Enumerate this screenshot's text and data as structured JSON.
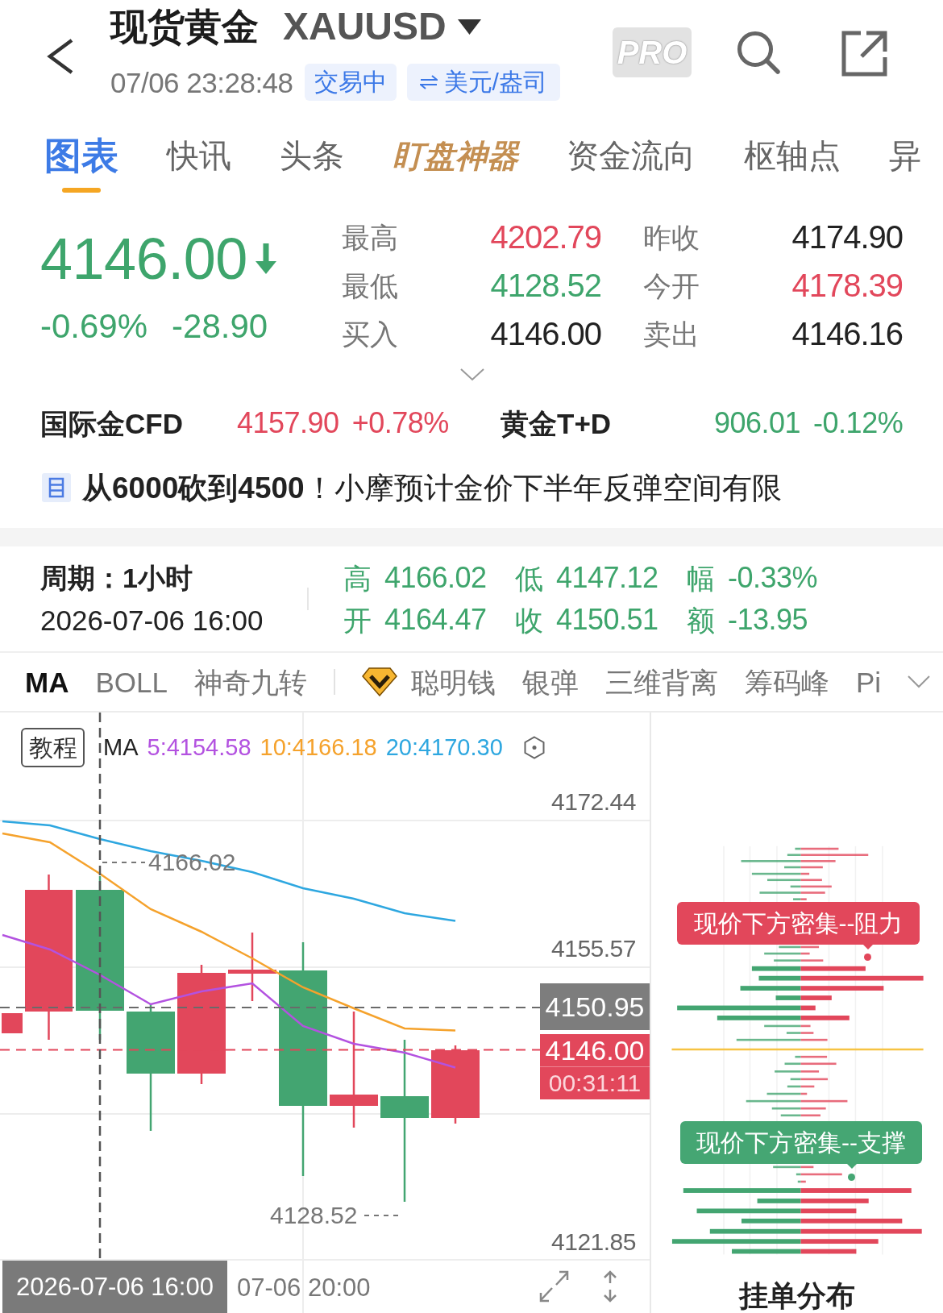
{
  "header": {
    "title": "现货黄金",
    "symbol": "XAUUSD",
    "timestamp": "07/06 23:28:48",
    "badges": [
      {
        "kind": "status",
        "label": "交易中"
      },
      {
        "kind": "unit",
        "label": "美元/盎司"
      }
    ],
    "pro_label": "PRO"
  },
  "tabs": [
    {
      "label": "图表",
      "selected": true,
      "kind": "plain"
    },
    {
      "label": "快讯",
      "selected": false,
      "kind": "plain"
    },
    {
      "label": "头条",
      "selected": false,
      "kind": "plain"
    },
    {
      "label": "盯盘神器",
      "selected": false,
      "kind": "promo"
    },
    {
      "label": "资金流向",
      "selected": false,
      "kind": "plain"
    },
    {
      "label": "枢轴点",
      "selected": false,
      "kind": "plain"
    },
    {
      "label": "异",
      "selected": false,
      "kind": "plain"
    }
  ],
  "quote": {
    "price": "4146.00",
    "rising": false,
    "falling": true,
    "change_percent": "-0.69%",
    "change": "-28.90",
    "stats": [
      {
        "label": "最高",
        "value": "4202.79",
        "rising": true,
        "falling": false
      },
      {
        "label": "昨收",
        "value": "4174.90",
        "rising": false,
        "falling": false
      },
      {
        "label": "最低",
        "value": "4128.52",
        "rising": false,
        "falling": true
      },
      {
        "label": "今开",
        "value": "4178.39",
        "rising": true,
        "falling": false
      },
      {
        "label": "买入",
        "value": "4146.00",
        "rising": false,
        "falling": false
      },
      {
        "label": "卖出",
        "value": "4146.16",
        "rising": false,
        "falling": false
      }
    ]
  },
  "markets": [
    {
      "name": "国际金CFD",
      "price": "4157.90",
      "change": "+0.78%",
      "rising": true,
      "falling": false
    },
    {
      "name": "黄金T+D",
      "price": "906.01",
      "change": "-0.12%",
      "rising": false,
      "falling": true
    }
  ],
  "news": {
    "headline": "**从6000砍到4500**！小摩预计金价下半年反弹空间有限"
  },
  "period": {
    "label": "周期：1小时",
    "datetime": "2026-07-06 16:00",
    "rising": false,
    "falling": true,
    "stats": [
      {
        "label": "高",
        "value": "4166.02"
      },
      {
        "label": "低",
        "value": "4147.12"
      },
      {
        "label": "幅",
        "value": "-0.33%"
      },
      {
        "label": "开",
        "value": "4164.47"
      },
      {
        "label": "收",
        "value": "4150.51"
      },
      {
        "label": "额",
        "value": "-13.95"
      }
    ]
  },
  "indicators": {
    "basic": [
      {
        "label": "MA",
        "selected": true
      },
      {
        "label": "BOLL",
        "selected": false
      },
      {
        "label": "神奇九转",
        "selected": false
      }
    ],
    "advanced": [
      {
        "label": "聪明钱",
        "selected": false,
        "vip": true
      },
      {
        "label": "银弹",
        "selected": false,
        "vip": false
      },
      {
        "label": "三维背离",
        "selected": false,
        "vip": false
      },
      {
        "label": "筹码峰",
        "selected": false,
        "vip": false
      },
      {
        "label": "Pi",
        "selected": false,
        "vip": false
      }
    ]
  },
  "chart": {
    "tutorial_button": "教程",
    "legend": {
      "label": "MA",
      "items": [
        {
          "text": "5:4154.58",
          "color": "#b352e0"
        },
        {
          "text": "10:4166.18",
          "color": "#f5a22c"
        },
        {
          "text": "20:4170.30",
          "color": "#2ea7e0"
        }
      ]
    },
    "y_labels": [
      "4172.44",
      "4155.57",
      "4121.85"
    ],
    "high_marker": "4166.02",
    "low_marker": "4128.52",
    "last_close_tag": "4150.95",
    "price_tag": {
      "price": "4146.00",
      "countdown": "00:31:11"
    },
    "crosshair_time": "2026-07-06 16:00",
    "time_labels": [
      "07-06 20:00"
    ]
  },
  "order_book": {
    "callouts": [
      {
        "kind": "resistance",
        "text": "现价下方密集--阻力"
      },
      {
        "kind": "support",
        "text": "现价下方密集--支撑"
      }
    ],
    "title": "挂单分布"
  }
}
